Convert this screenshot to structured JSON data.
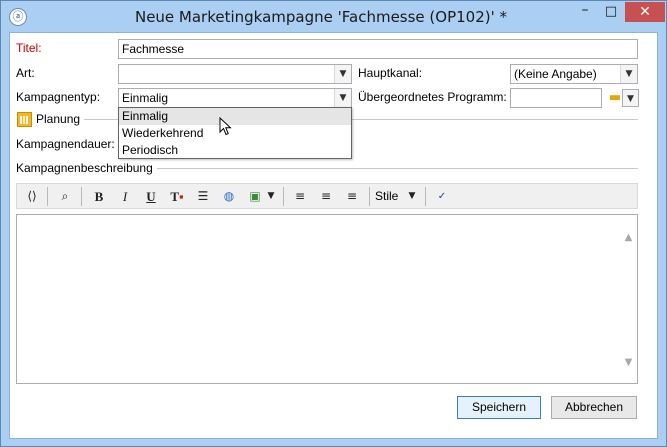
{
  "window": {
    "title": "Neue Marketingkampagne 'Fachmesse (OP102)' *",
    "app_icon": "app-logo-icon",
    "controls": {
      "minimize": "–",
      "maximize": "□",
      "close": "✕"
    }
  },
  "form": {
    "titel": {
      "label": "Titel:",
      "value": "Fachmesse"
    },
    "art": {
      "label": "Art:",
      "value": ""
    },
    "hauptkanal": {
      "label": "Hauptkanal:",
      "value": "(Keine Angabe)"
    },
    "kampagnentyp": {
      "label": "Kampagnentyp:",
      "value": "Einmalig"
    },
    "programm": {
      "label": "Übergeordnetes Programm:",
      "value": ""
    }
  },
  "dropdown": {
    "options": [
      "Einmalig",
      "Wiederkehrend",
      "Periodisch"
    ],
    "hovered_index": 0
  },
  "sections": {
    "planung": "Planung",
    "kampagnendauer": "Kampagnendauer:",
    "beschreibung": "Kampagnenbeschreibung"
  },
  "toolbar": {
    "bold": "B",
    "italic": "I",
    "underline": "U",
    "styles_label": "Stile"
  },
  "buttons": {
    "save": "Speichern",
    "cancel": "Abbrechen"
  },
  "colors": {
    "titlebar": "#abcff2",
    "required_label": "#cc0000",
    "close_button": "#c75050"
  }
}
